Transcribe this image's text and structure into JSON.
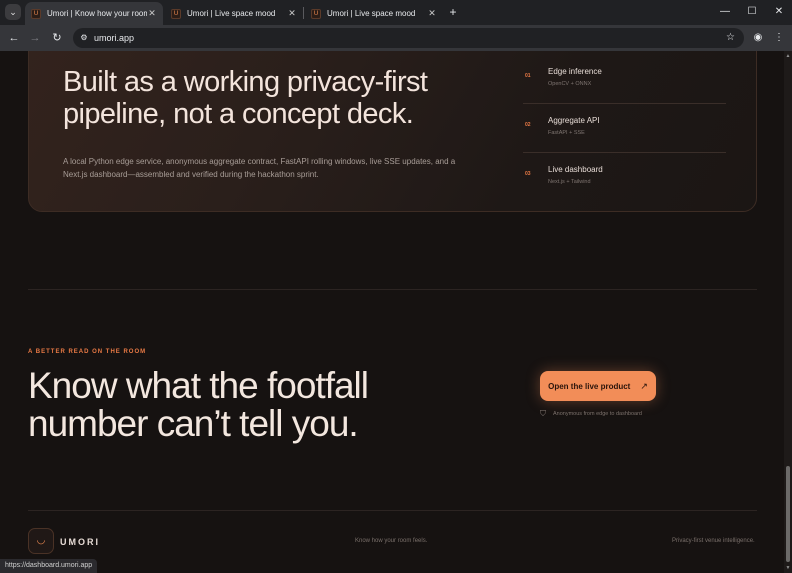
{
  "browser": {
    "tabs": [
      {
        "title": "Umori | Know how your room feels",
        "active": true
      },
      {
        "title": "Umori | Live space mood",
        "active": false
      },
      {
        "title": "Umori | Live space mood",
        "active": false
      }
    ],
    "new_tab": "+",
    "url": "umori.app",
    "status_url": "https://dashboard.umori.app"
  },
  "icons": {
    "tab_search": "chevron-down-icon",
    "favicon": "umori-favicon",
    "close": "close-icon",
    "back": "back-arrow-icon",
    "forward": "forward-arrow-icon",
    "reload": "reload-icon",
    "site_info": "tune-icon",
    "bookmark": "star-icon",
    "profile": "profile-icon",
    "menu": "kebab-menu-icon",
    "cta_arrow": "arrow-up-right-icon",
    "shield": "shield-icon"
  },
  "card": {
    "title": "Built as a working privacy-first pipeline, not a concept deck.",
    "description": "A local Python edge service, anonymous aggregate contract, FastAPI rolling windows, live SSE updates, and a Next.js dashboard—assembled and verified during the hackathon sprint.",
    "steps": [
      {
        "num": "01",
        "name": "Edge inference",
        "tech": "OpenCV + ONNX"
      },
      {
        "num": "02",
        "name": "Aggregate API",
        "tech": "FastAPI + SSE"
      },
      {
        "num": "03",
        "name": "Live dashboard",
        "tech": "Next.js + Tailwind"
      }
    ]
  },
  "cta_section": {
    "eyebrow": "A BETTER READ ON THE ROOM",
    "headline": "Know what the footfall number can’t tell you.",
    "button_label": "Open the live product",
    "note": "Anonymous from edge to dashboard"
  },
  "footer": {
    "brand": "UMORI",
    "tagline": "Know how your room feels.",
    "right_text": "Privacy-first venue intelligence."
  },
  "colors": {
    "accent": "#f28d58",
    "background": "#161211"
  }
}
